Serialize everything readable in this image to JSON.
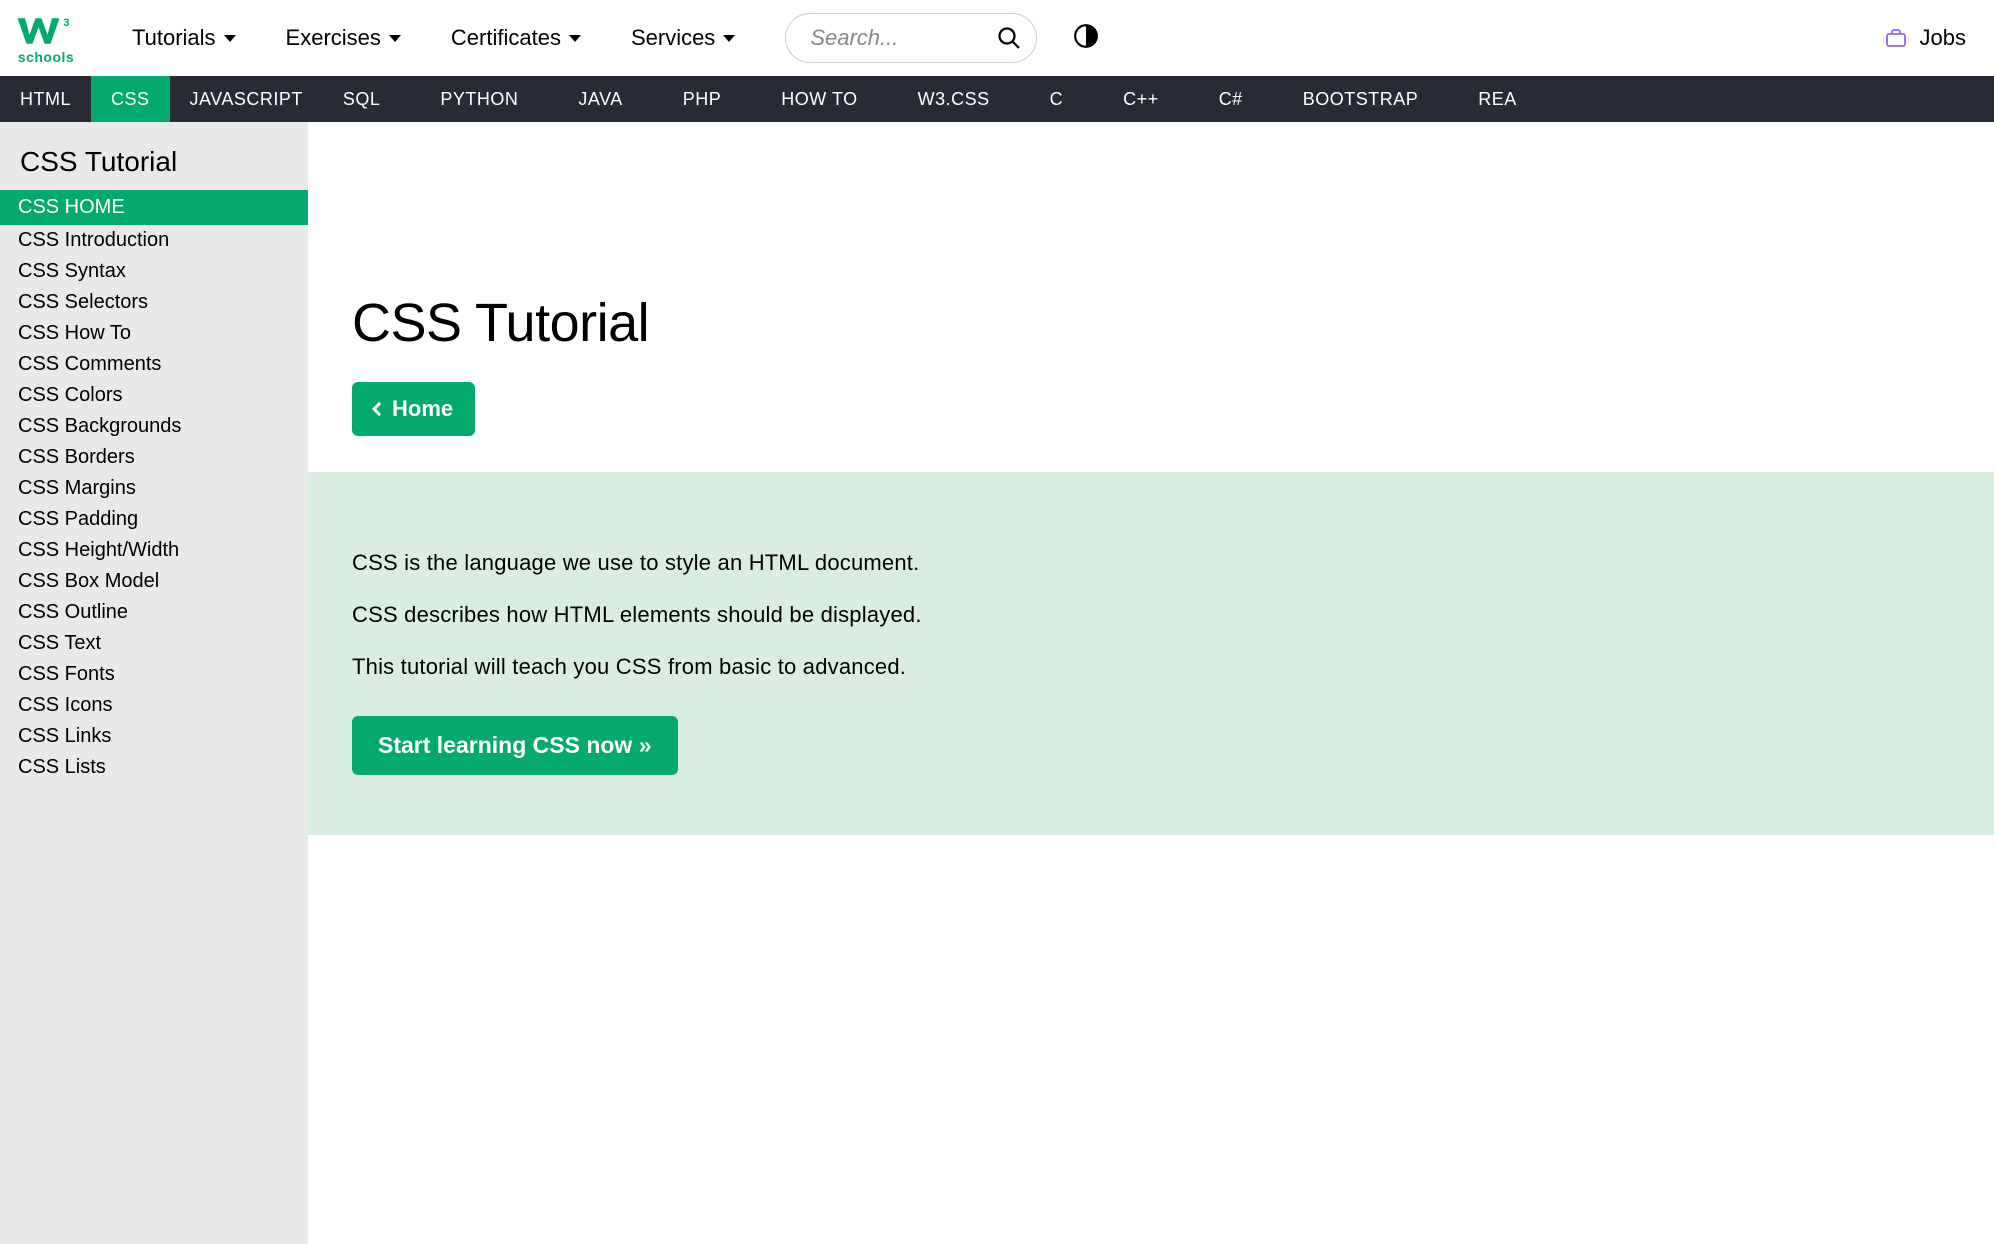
{
  "brand": {
    "name": "schools"
  },
  "topnav": {
    "items": [
      {
        "label": "Tutorials"
      },
      {
        "label": "Exercises"
      },
      {
        "label": "Certificates"
      },
      {
        "label": "Services"
      }
    ],
    "search_placeholder": "Search...",
    "jobs_label": "Jobs"
  },
  "secnav": {
    "items": [
      "HTML",
      "CSS",
      "JAVASCRIPT",
      "SQL",
      "PYTHON",
      "JAVA",
      "PHP",
      "HOW TO",
      "W3.CSS",
      "C",
      "C++",
      "C#",
      "BOOTSTRAP",
      "REA"
    ],
    "active": "CSS"
  },
  "sidebar": {
    "title": "CSS Tutorial",
    "items": [
      {
        "label": "CSS HOME",
        "active": true
      },
      {
        "label": "CSS Introduction"
      },
      {
        "label": "CSS Syntax"
      },
      {
        "label": "CSS Selectors"
      },
      {
        "label": "CSS How To"
      },
      {
        "label": "CSS Comments"
      },
      {
        "label": "CSS Colors"
      },
      {
        "label": "CSS Backgrounds"
      },
      {
        "label": "CSS Borders"
      },
      {
        "label": "CSS Margins"
      },
      {
        "label": "CSS Padding"
      },
      {
        "label": "CSS Height/Width"
      },
      {
        "label": "CSS Box Model"
      },
      {
        "label": "CSS Outline"
      },
      {
        "label": "CSS Text"
      },
      {
        "label": "CSS Fonts"
      },
      {
        "label": "CSS Icons"
      },
      {
        "label": "CSS Links"
      },
      {
        "label": "CSS Lists"
      }
    ]
  },
  "main": {
    "title": "CSS Tutorial",
    "home_button": "Home",
    "intro": {
      "p1": "CSS is the language we use to style an HTML document.",
      "p2": "CSS describes how HTML elements should be displayed.",
      "p3": "This tutorial will teach you CSS from basic to advanced."
    },
    "start_button": "Start learning CSS now »"
  }
}
